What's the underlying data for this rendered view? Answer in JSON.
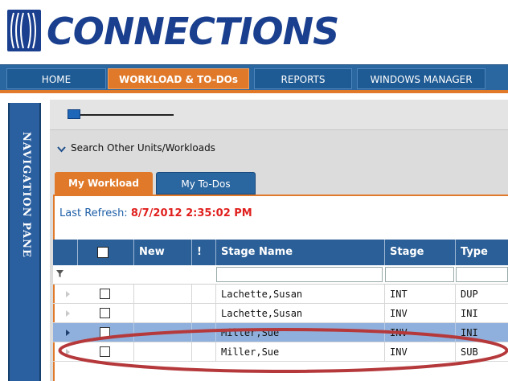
{
  "app": {
    "name": "CONNECTIONS",
    "colors": {
      "brand_blue": "#1a3f8e",
      "accent_orange": "#e07a2a",
      "nav_blue": "#2a66a0",
      "refresh_red": "#e0201e",
      "highlight_ring": "#b5383b"
    }
  },
  "nav": {
    "tabs": [
      {
        "label": "HOME",
        "active": false
      },
      {
        "label": "WORKLOAD & TO-DOs",
        "active": true
      },
      {
        "label": "REPORTS",
        "active": false
      },
      {
        "label": "WINDOWS MANAGER",
        "active": false
      }
    ]
  },
  "navigation_pane": {
    "label": "NAVIGATION PANE"
  },
  "search": {
    "label": "Search Other Units/Workloads",
    "icon": "chevron-down-icon"
  },
  "workload_tabs": [
    {
      "label": "My Workload",
      "active": true
    },
    {
      "label": "My To-Dos",
      "active": false
    }
  ],
  "refresh": {
    "label": "Last Refresh:",
    "value": "8/7/2012 2:35:02 PM"
  },
  "grid": {
    "columns": [
      "New",
      "!",
      "Stage Name",
      "Stage",
      "Type"
    ],
    "filter_icon": "funnel-icon",
    "rows": [
      {
        "stage_name": "Lachette,Susan",
        "stage": "INT",
        "type": "DUP",
        "selected": false
      },
      {
        "stage_name": "Lachette,Susan",
        "stage": "INV",
        "type": "INI",
        "selected": false
      },
      {
        "stage_name": "Miller,Sue",
        "stage": "INV",
        "type": "INI",
        "selected": true
      },
      {
        "stage_name": "Miller,Sue",
        "stage": "INV",
        "type": "SUB",
        "selected": false
      }
    ]
  }
}
